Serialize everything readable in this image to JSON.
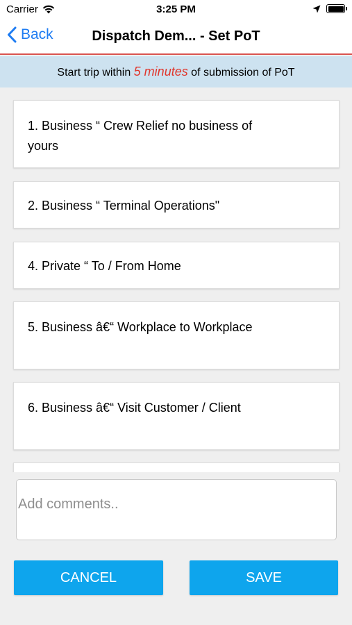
{
  "status": {
    "carrier": "Carrier",
    "time": "3:25 PM"
  },
  "nav": {
    "back_label": "Back",
    "title": "Dispatch Dem... - Set PoT"
  },
  "banner": {
    "prefix": "Start trip within",
    "highlight": "5 minutes",
    "suffix": "of submission of PoT"
  },
  "options": [
    {
      "label": "1. Business “ Crew Relief no business of yours"
    },
    {
      "label": "2. Business “ Terminal Operations\""
    },
    {
      "label": "4. Private “ To / From Home"
    },
    {
      "label": "5. Business â€“ Workplace to Workplace"
    },
    {
      "label": "6. Business â€“ Visit Customer / Client"
    }
  ],
  "comments": {
    "placeholder": "Add comments.."
  },
  "buttons": {
    "cancel": "CANCEL",
    "save": "SAVE"
  },
  "colors": {
    "accent_blue": "#0ea5ed",
    "nav_link": "#1e7cf2",
    "highlight_red": "#e0362c",
    "banner_bg": "#cde2f0"
  }
}
